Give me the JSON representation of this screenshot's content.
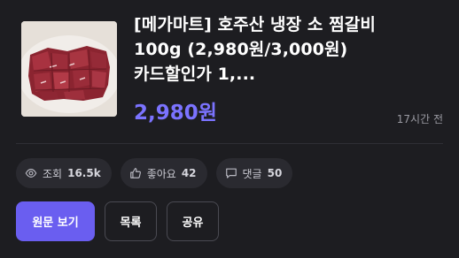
{
  "listing": {
    "title_lines": [
      "[메가마트] 호주산 냉장 소 찜갈비",
      "100g (2,980원/3,000원)",
      "카드할인가 1,..."
    ],
    "price": "2,980원",
    "time": "17시간 전",
    "image_alt": "raw beef short ribs on a plate"
  },
  "stats": [
    {
      "icon": "eye-icon",
      "label": "조회",
      "value": "16.5k"
    },
    {
      "icon": "thumbs-up-icon",
      "label": "좋아요",
      "value": "42"
    },
    {
      "icon": "comment-icon",
      "label": "댓글",
      "value": "50"
    }
  ],
  "actions": {
    "view_original": "원문 보기",
    "list": "목록",
    "share": "공유"
  },
  "colors": {
    "background": "#1d1d21",
    "accent": "#6a5ef0",
    "price": "#7b73ff",
    "chip": "#2a2a30"
  }
}
